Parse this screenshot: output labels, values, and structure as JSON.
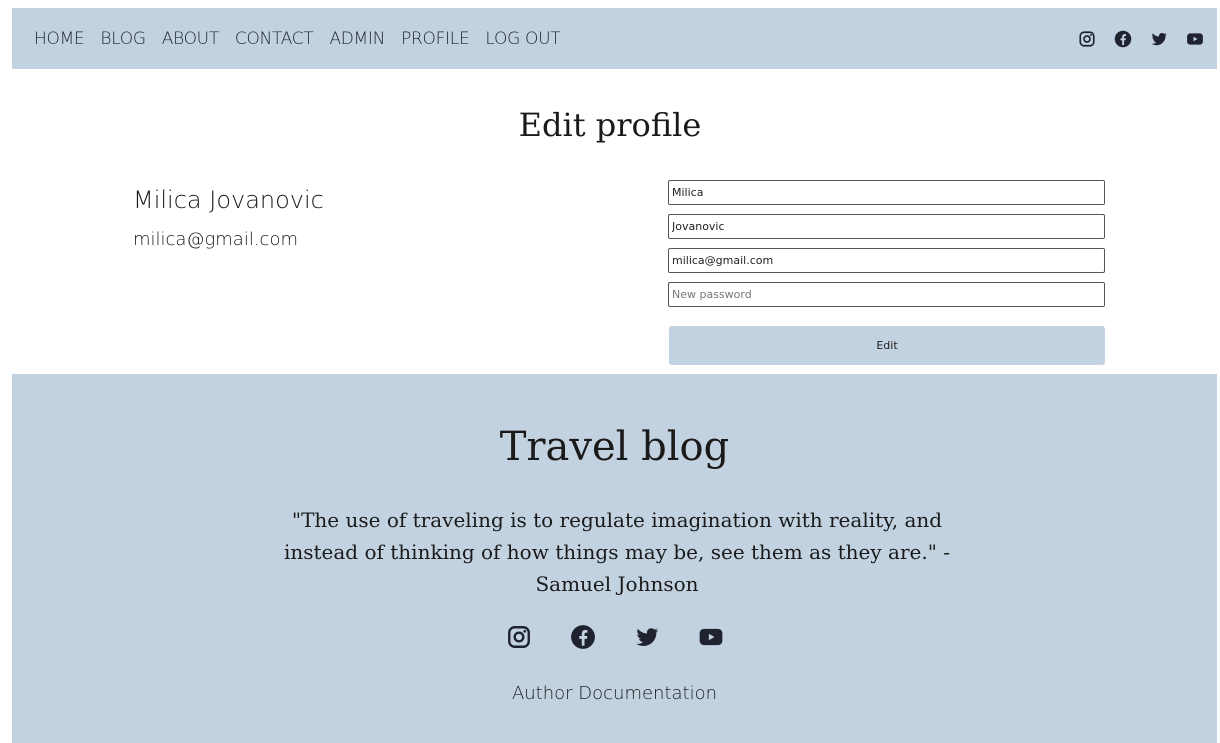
{
  "nav": {
    "links": [
      {
        "label": "HOME"
      },
      {
        "label": "BLOG"
      },
      {
        "label": "ABOUT"
      },
      {
        "label": "CONTACT"
      },
      {
        "label": "ADMIN"
      },
      {
        "label": "PROFILE"
      },
      {
        "label": "LOG OUT"
      }
    ],
    "social": [
      "instagram-icon",
      "facebook-icon",
      "twitter-icon",
      "youtube-icon"
    ]
  },
  "page": {
    "title": "Edit profile"
  },
  "user": {
    "name": "Milica Jovanovic",
    "email": "milica@gmail.com"
  },
  "form": {
    "first_name_value": "Milica",
    "last_name_value": "Jovanovic",
    "email_value": "milica@gmail.com",
    "password_placeholder": "New password",
    "submit_label": "Edit"
  },
  "footer": {
    "title": "Travel blog",
    "quote": "\"The use of traveling is to regulate imagination with reality, and instead of thinking of how things may be, see them as they are.\" - Samuel Johnson",
    "link_label": "Author Documentation",
    "social": [
      "instagram-icon",
      "facebook-icon",
      "twitter-icon",
      "youtube-icon"
    ]
  },
  "colors": {
    "bar_background": "#c3d2e1",
    "text": "#1f2330"
  }
}
